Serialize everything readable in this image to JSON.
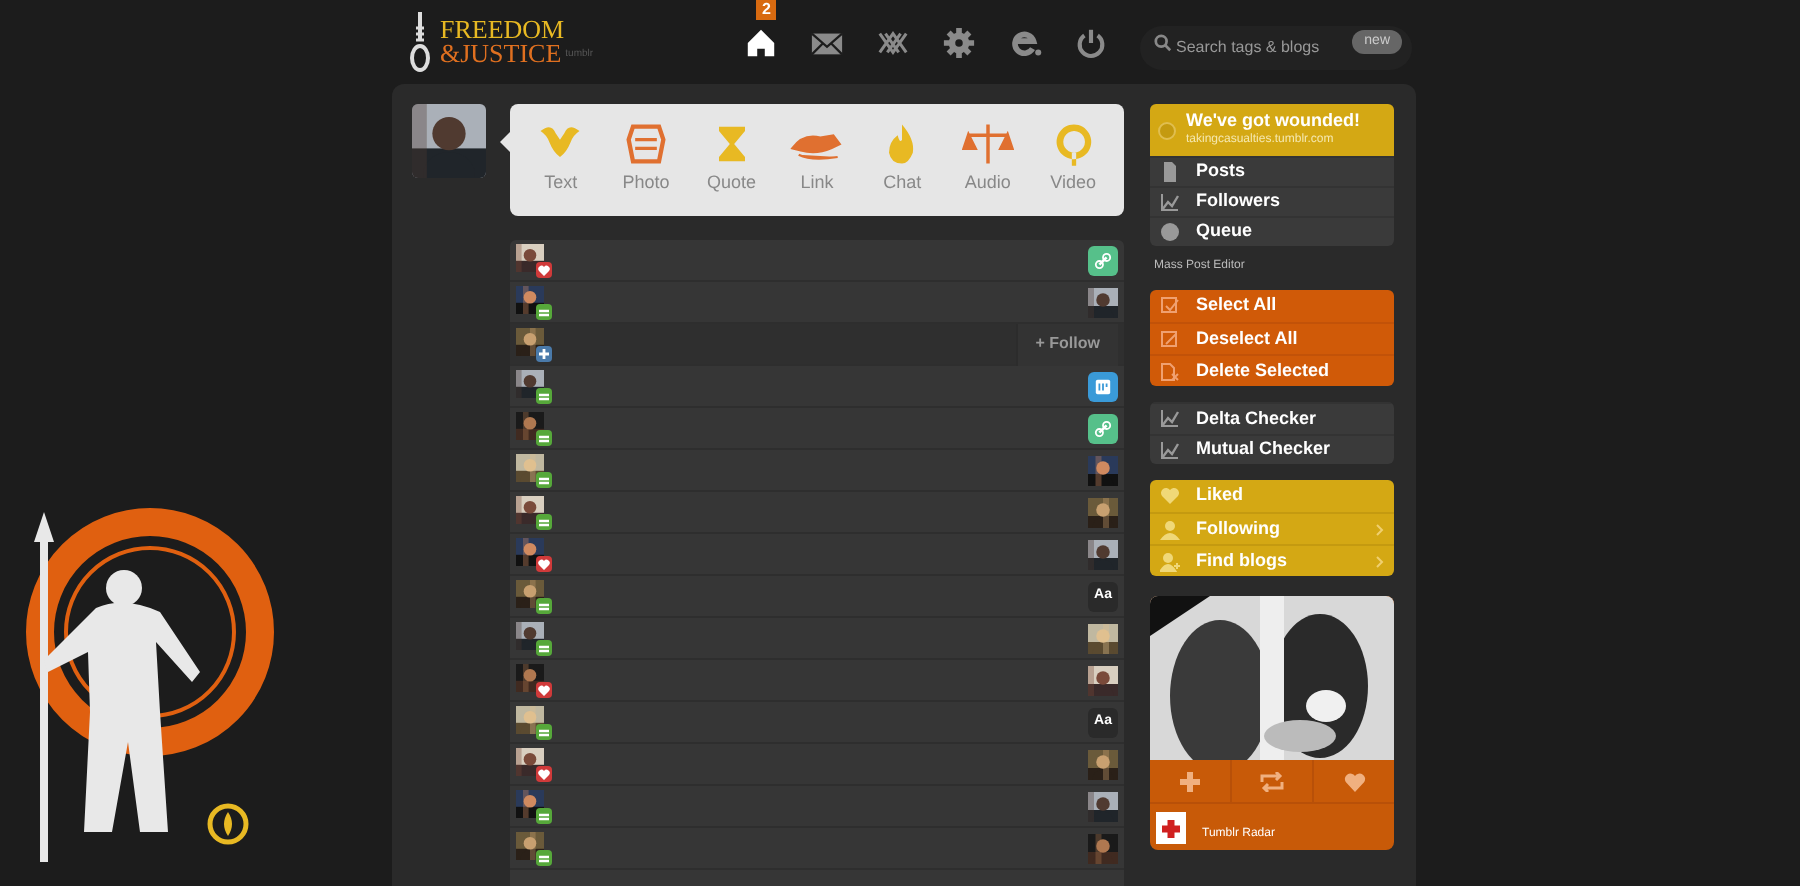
{
  "logo": {
    "line_1": "FREEDOM",
    "line_2": "&JUSTICE",
    "suffix": "tumblr"
  },
  "nav": [
    {
      "kind": "home",
      "selected": true,
      "badge": "2"
    },
    {
      "kind": "mail",
      "selected": false
    },
    {
      "kind": "activity",
      "selected": false
    },
    {
      "kind": "settings",
      "selected": false
    },
    {
      "kind": "explore",
      "selected": false
    },
    {
      "kind": "logout",
      "selected": false
    }
  ],
  "search": {
    "placeholder": "Search tags & blogs",
    "badge": "new"
  },
  "post_types": [
    {
      "label": "Text",
      "color": "#e8b923"
    },
    {
      "label": "Photo",
      "color": "#e07030"
    },
    {
      "label": "Quote",
      "color": "#e8b923"
    },
    {
      "label": "Link",
      "color": "#e07030"
    },
    {
      "label": "Chat",
      "color": "#e8b923"
    },
    {
      "label": "Audio",
      "color": "#e07030"
    },
    {
      "label": "Video",
      "color": "#e8b923"
    }
  ],
  "activity": [
    {
      "kind": "like",
      "post": {
        "kind": "link"
      }
    },
    {
      "kind": "reblog"
    },
    {
      "kind": "follow",
      "post": {
        "kind": "follow_button",
        "label": "+ Follow"
      }
    },
    {
      "kind": "reblog",
      "post": {
        "kind": "chat"
      }
    },
    {
      "kind": "reblog",
      "post": {
        "kind": "link"
      }
    },
    {
      "kind": "reblog"
    },
    {
      "kind": "reblog"
    },
    {
      "kind": "like"
    },
    {
      "kind": "reblog",
      "post": {
        "kind": "text",
        "label": "Aa"
      }
    },
    {
      "kind": "reblog"
    },
    {
      "kind": "like"
    },
    {
      "kind": "reblog",
      "post": {
        "kind": "text",
        "label": "Aa"
      }
    },
    {
      "kind": "like"
    },
    {
      "kind": "reblog"
    },
    {
      "kind": "reblog"
    }
  ],
  "blog_card": {
    "title": "We've got wounded!",
    "url": "takingcasualties.tumblr.com"
  },
  "blog_menu": [
    {
      "label": "Posts"
    },
    {
      "label": "Followers"
    },
    {
      "label": "Queue"
    }
  ],
  "mass_post_editor": {
    "title": "Mass Post Editor",
    "actions": [
      {
        "label": "Select All"
      },
      {
        "label": "Deselect All"
      },
      {
        "label": "Delete Selected"
      }
    ]
  },
  "checkers": [
    {
      "label": "Delta Checker"
    },
    {
      "label": "Mutual Checker"
    }
  ],
  "activity_menu": [
    {
      "label": "Liked",
      "has_submenu": false
    },
    {
      "label": "Following",
      "has_submenu": true
    },
    {
      "label": "Find blogs",
      "has_submenu": true
    }
  ],
  "radar": {
    "blog": "Tumblr Radar"
  }
}
